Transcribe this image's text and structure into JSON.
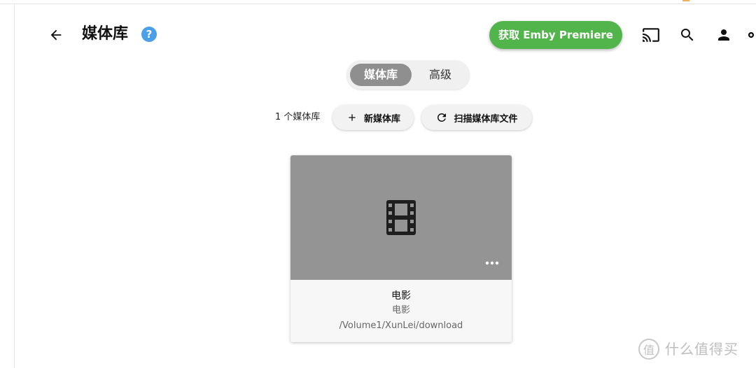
{
  "header": {
    "title": "媒体库",
    "help_symbol": "?",
    "premiere_button": "获取 Emby Premiere",
    "icons": [
      "back-arrow-icon",
      "help-icon",
      "cast-icon",
      "search-icon",
      "user-icon",
      "settings-icon"
    ]
  },
  "tabs": [
    {
      "label": "媒体库",
      "active": true
    },
    {
      "label": "高级",
      "active": false
    }
  ],
  "toolbar": {
    "count_label": "1 个媒体库",
    "new_library": "新媒体库",
    "scan_files": "扫描媒体库文件"
  },
  "libraries": [
    {
      "title": "电影",
      "type": "电影",
      "path": "/Volume1/XunLei/download",
      "icon": "movie-film-icon"
    }
  ],
  "watermark": {
    "logo_char": "值",
    "text": "什么值得买"
  },
  "colors": {
    "accent_green": "#52b54b",
    "help_blue": "#4a9fe8",
    "tab_active": "#8f8f8f",
    "card_image": "#949494"
  }
}
